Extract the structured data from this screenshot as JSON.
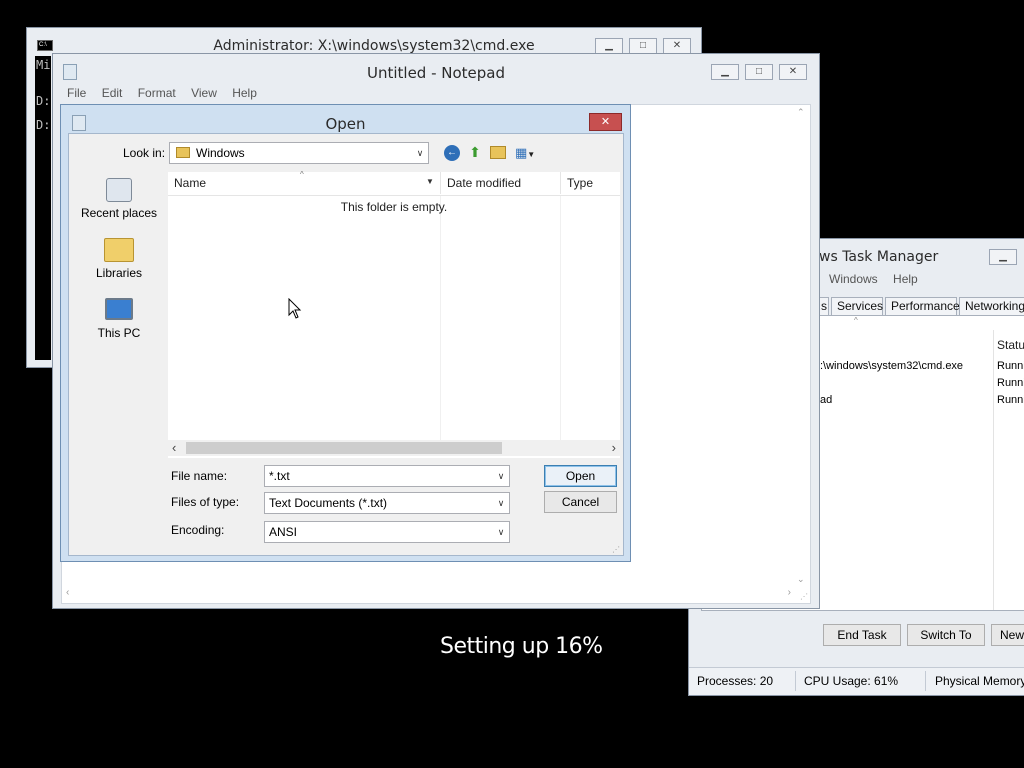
{
  "cmd": {
    "title": "Administrator: X:\\windows\\system32\\cmd.exe",
    "lines": [
      "Mi",
      "D:",
      "D:"
    ]
  },
  "notepad": {
    "title": "Untitled - Notepad",
    "menu": [
      "File",
      "Edit",
      "Format",
      "View",
      "Help"
    ]
  },
  "task_manager": {
    "title": "ws Task Manager",
    "menu": [
      "Windows",
      "Help"
    ],
    "tabs": [
      "s",
      "Services",
      "Performance",
      "Networking"
    ],
    "status_header": "Status",
    "rows": [
      {
        "task": ":\\windows\\system32\\cmd.exe",
        "status": "Runni"
      },
      {
        "task": "",
        "status": "Runni"
      },
      {
        "task": "ad",
        "status": "Runni"
      }
    ],
    "buttons": {
      "end_task": "End Task",
      "switch_to": "Switch To",
      "new": "New"
    },
    "statusbar": {
      "processes": "Processes: 20",
      "cpu": "CPU Usage: 61%",
      "memory": "Physical Memory"
    }
  },
  "setup": {
    "text": "Setting up 16%"
  },
  "open_dialog": {
    "title": "Open",
    "look_in_label": "Look in:",
    "look_in_value": "Windows",
    "places": [
      {
        "label": "Recent places",
        "icon": "recent-places-icon"
      },
      {
        "label": "Libraries",
        "icon": "libraries-icon"
      },
      {
        "label": "This PC",
        "icon": "this-pc-icon"
      }
    ],
    "columns": [
      "Name",
      "Date modified",
      "Type"
    ],
    "empty_message": "This folder is empty.",
    "file_name_label": "File name:",
    "file_name_value": "*.txt",
    "files_of_type_label": "Files of type:",
    "files_of_type_value": "Text Documents (*.txt)",
    "encoding_label": "Encoding:",
    "encoding_value": "ANSI",
    "open_button": "Open",
    "cancel_button": "Cancel"
  }
}
